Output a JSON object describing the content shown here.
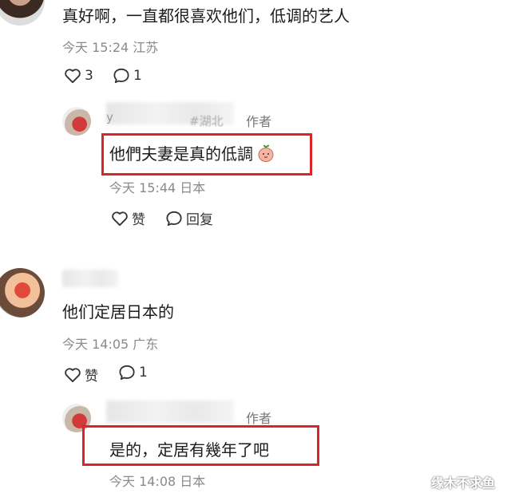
{
  "comments": [
    {
      "text": "真好啊，一直都很喜欢他们，低调的艺人",
      "time": "今天 15:24",
      "location": "江苏",
      "likes": "3",
      "replies": "1"
    },
    {
      "author_badge": "作者",
      "name_fragment_left": "у",
      "name_fragment_right": "#湖北",
      "text": "他們夫妻是真的低調",
      "time": "今天 15:44",
      "location": "日本",
      "like_label": "赞",
      "reply_label": "回复"
    },
    {
      "text": "他们定居日本的",
      "time": "今天 14:05",
      "location": "广东",
      "like_label": "赞",
      "replies": "1"
    },
    {
      "author_badge": "作者",
      "text": "是的，定居有幾年了吧",
      "time": "今天 14:08",
      "location": "日本"
    }
  ],
  "watermark": "缘木不求鱼",
  "colors": {
    "highlight": "#d9252a",
    "meta": "#8a8a8a"
  },
  "icons": [
    "heart-icon",
    "comment-icon",
    "peach-emoji-icon"
  ]
}
